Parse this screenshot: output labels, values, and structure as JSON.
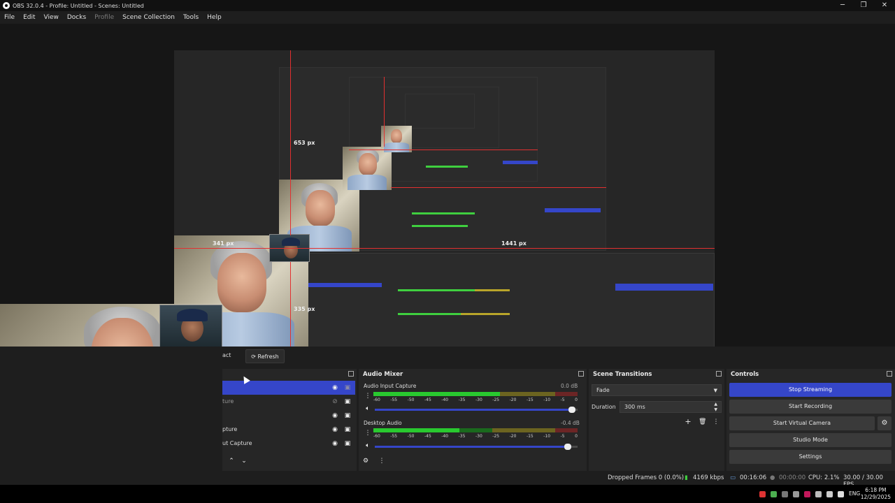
{
  "window": {
    "title": "OBS 32.0.4 - Profile: Untitled - Scenes: Untitled",
    "controls": [
      "─",
      "❐",
      "✕"
    ]
  },
  "menu": [
    "File",
    "Edit",
    "View",
    "Docks",
    "Profile",
    "Scene Collection",
    "Tools",
    "Help"
  ],
  "preview": {
    "labels": {
      "top": "653 px",
      "left": "341 px",
      "right": "1441 px",
      "bottom": "335 px"
    }
  },
  "sources_toolbar": {
    "properties_fragment": "act",
    "refresh_label": "Refresh"
  },
  "sources": [
    {
      "label": "",
      "selected": true
    },
    {
      "label": "ture",
      "selected": false
    },
    {
      "label": "",
      "selected": false
    },
    {
      "label": "pture",
      "selected": false
    },
    {
      "label": "ut Capture",
      "selected": false
    }
  ],
  "audio_mixer": {
    "title": "Audio Mixer",
    "channels": [
      {
        "name": "Audio Input Capture",
        "db": "0.0 dB",
        "level": 0.62,
        "volume": 0.99
      },
      {
        "name": "Desktop Audio",
        "db": "-0.4 dB",
        "level": 0.42,
        "volume": 0.97
      }
    ],
    "ticks": [
      "-60",
      "-55",
      "-50",
      "-45",
      "-40",
      "-35",
      "-30",
      "-25",
      "-20",
      "-15",
      "-10",
      "-5",
      "0"
    ]
  },
  "transitions": {
    "title": "Scene Transitions",
    "selected": "Fade",
    "duration_label": "Duration",
    "duration_value": "300 ms"
  },
  "controls": {
    "title": "Controls",
    "stop_streaming": "Stop Streaming",
    "start_recording": "Start Recording",
    "start_virtual_camera": "Start Virtual Camera",
    "studio_mode": "Studio Mode",
    "settings": "Settings"
  },
  "status": {
    "dropped_frames": "Dropped Frames 0 (0.0%)",
    "bitrate": "4169 kbps",
    "stream_time": "00:16:06",
    "record_time": "00:00:00",
    "cpu": "CPU: 2.1%",
    "fps": "30.00 / 30.00 FPS"
  },
  "taskbar": {
    "language": "ENG",
    "time": "6:18 PM",
    "date": "12/29/2025"
  },
  "colors": {
    "accent": "#3546c9",
    "guide": "#e23030",
    "meter_green": "#29c92f"
  }
}
